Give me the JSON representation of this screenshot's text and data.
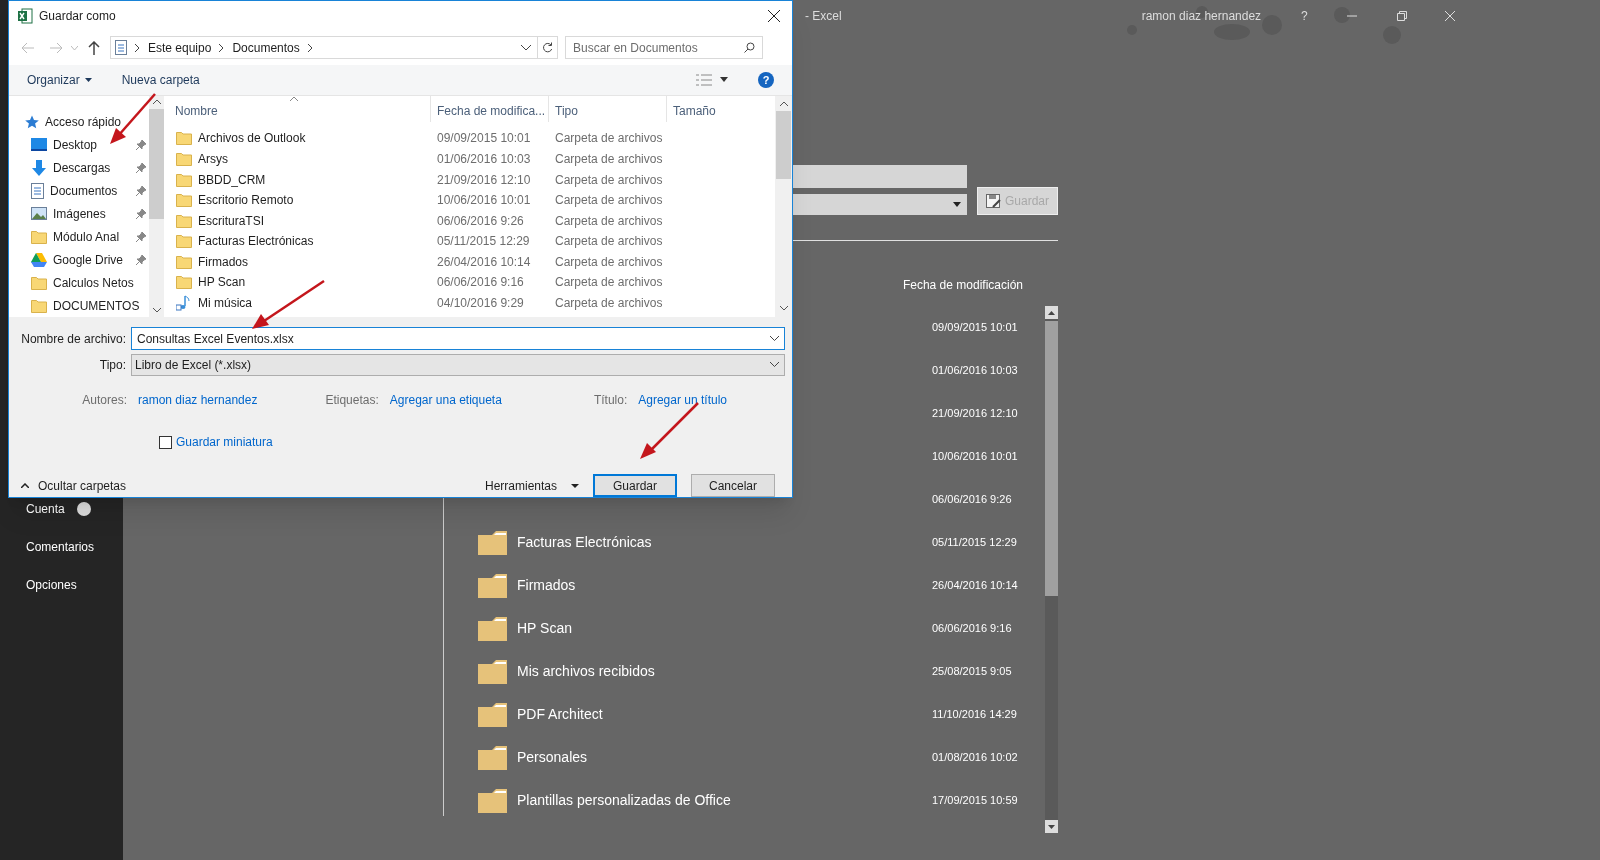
{
  "app": {
    "title": "-  Excel",
    "user": "ramon diaz hernandez",
    "help": "?"
  },
  "menu": [
    {
      "label": "Cuenta",
      "alert": true
    },
    {
      "label": "Comentarios",
      "alert": false
    },
    {
      "label": "Opciones",
      "alert": false
    }
  ],
  "save_button": {
    "label": "Guardar",
    "disabled": true
  },
  "list_header": "Fecha de modificación",
  "files": [
    {
      "date": "09/09/2015 10:01"
    },
    {
      "date": "01/06/2016 10:03"
    },
    {
      "date": "21/09/2016 12:10"
    },
    {
      "date": "10/06/2016 10:01"
    },
    {
      "date": "06/06/2016 9:26"
    },
    {
      "name": "Facturas Electrónicas",
      "date": "05/11/2015 12:29"
    },
    {
      "name": "Firmados",
      "date": "26/04/2016 10:14"
    },
    {
      "name": "HP Scan",
      "date": "06/06/2016 9:16"
    },
    {
      "name": "Mis archivos recibidos",
      "date": "25/08/2015 9:05"
    },
    {
      "name": "PDF Architect",
      "date": "11/10/2016 14:29"
    },
    {
      "name": "Personales",
      "date": "01/08/2016 10:02"
    },
    {
      "name": "Plantillas personalizadas de Office",
      "date": "17/09/2015 10:59"
    }
  ],
  "dialog": {
    "title": "Guardar como",
    "crumbs": [
      "Este equipo",
      "Documentos"
    ],
    "search_placeholder": "Buscar en Documentos",
    "organize": "Organizar",
    "new_folder": "Nueva carpeta",
    "help": "?",
    "nav": [
      {
        "label": "Acceso rápido",
        "kind": "star",
        "pinned": false
      },
      {
        "label": "Desktop",
        "kind": "desktop",
        "pinned": true
      },
      {
        "label": "Descargas",
        "kind": "download",
        "pinned": true
      },
      {
        "label": "Documentos",
        "kind": "document",
        "pinned": true
      },
      {
        "label": "Imágenes",
        "kind": "image",
        "pinned": true
      },
      {
        "label": "Módulo Anal",
        "kind": "folder",
        "pinned": true
      },
      {
        "label": "Google Drive",
        "kind": "drive",
        "pinned": true
      },
      {
        "label": "Calculos Netos",
        "kind": "folder",
        "pinned": false
      },
      {
        "label": "DOCUMENTOS",
        "kind": "folder",
        "pinned": false
      }
    ],
    "columns": [
      "Nombre",
      "Fecha de modifica...",
      "Tipo",
      "Tamaño"
    ],
    "files": [
      {
        "name": "Archivos de Outlook",
        "date": "09/09/2015 10:01",
        "type": "Carpeta de archivos",
        "kind": "folder"
      },
      {
        "name": "Arsys",
        "date": "01/06/2016 10:03",
        "type": "Carpeta de archivos",
        "kind": "folder"
      },
      {
        "name": "BBDD_CRM",
        "date": "21/09/2016 12:10",
        "type": "Carpeta de archivos",
        "kind": "folder"
      },
      {
        "name": "Escritorio Remoto",
        "date": "10/06/2016 10:01",
        "type": "Carpeta de archivos",
        "kind": "folder"
      },
      {
        "name": "EscrituraTSI",
        "date": "06/06/2016 9:26",
        "type": "Carpeta de archivos",
        "kind": "folder"
      },
      {
        "name": "Facturas Electrónicas",
        "date": "05/11/2015 12:29",
        "type": "Carpeta de archivos",
        "kind": "folder"
      },
      {
        "name": "Firmados",
        "date": "26/04/2016 10:14",
        "type": "Carpeta de archivos",
        "kind": "folder"
      },
      {
        "name": "HP Scan",
        "date": "06/06/2016 9:16",
        "type": "Carpeta de archivos",
        "kind": "folder"
      },
      {
        "name": "Mi música",
        "date": "04/10/2016 9:29",
        "type": "Carpeta de archivos",
        "kind": "music"
      }
    ],
    "filename": {
      "label": "Nombre de archivo:",
      "value": "Consultas Excel Eventos.xlsx"
    },
    "filetype": {
      "label": "Tipo:",
      "value": "Libro de Excel (*.xlsx)"
    },
    "meta": [
      {
        "label": "Autores:",
        "value": "ramon diaz hernandez"
      },
      {
        "label": "Etiquetas:",
        "value": "Agregar una etiqueta"
      },
      {
        "label": "Título:",
        "value": "Agregar un título"
      }
    ],
    "thumbnail": {
      "label": "Guardar miniatura",
      "checked": false
    },
    "hide_folders": "Ocultar carpetas",
    "tools": "Herramientas",
    "buttons": [
      {
        "label": "Guardar",
        "default": true
      },
      {
        "label": "Cancelar",
        "default": false
      }
    ]
  }
}
